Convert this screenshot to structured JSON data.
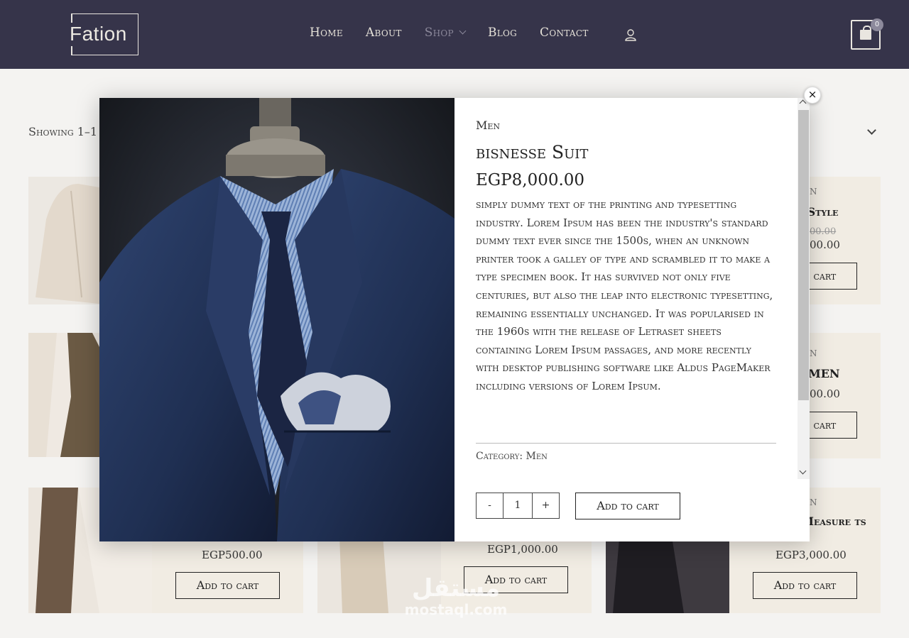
{
  "header": {
    "logo": "Fation",
    "nav": [
      {
        "label": "Home"
      },
      {
        "label": "About"
      },
      {
        "label": "Shop"
      },
      {
        "label": "Blog"
      },
      {
        "label": "Contact"
      }
    ],
    "cart_count": "0"
  },
  "shop": {
    "showing": "Showing 1–1",
    "cards": [
      {
        "category": "N",
        "title": "-Style",
        "old_price": "00.00",
        "price": "00.00",
        "button": "Add to cart"
      },
      {
        "category": "N",
        "title": "MEN",
        "price": "00.00",
        "button": "Add to cart"
      },
      {
        "price": "EGP500.00",
        "button": "Add to cart"
      },
      {
        "price": "EGP1,000.00",
        "button": "Add to cart"
      },
      {
        "category": "N",
        "title": "Measure ts",
        "price": "EGP3,000.00",
        "button": "Add to cart"
      }
    ]
  },
  "modal": {
    "close_icon": "×",
    "category": "Men",
    "title": "bisnesse Suit",
    "price": "EGP8,000.00",
    "description": "simply dummy text of the printing and typesetting industry. Lorem Ipsum has been the industry's standard dummy text ever since the 1500s, when an unknown printer took a galley of type and scrambled it to make a type specimen book. It has survived not only five centuries, but also the leap into electronic typesetting, remaining essentially unchanged. It was popularised in the 1960s with the release of Letraset sheets containing Lorem Ipsum passages, and more recently with desktop publishing software like Aldus PageMaker including versions of Lorem Ipsum.",
    "category_label": "Category:",
    "category_link": "Men",
    "qty_minus": "-",
    "qty_value": "1",
    "qty_plus": "+",
    "add_to_cart": "Add to cart"
  },
  "watermark": {
    "arabic": "مستقل",
    "english": "mostaql.com"
  },
  "colors": {
    "header_bg": "#36344a",
    "card_bg": "#f1ece3",
    "accent_muted": "#8a8799"
  }
}
